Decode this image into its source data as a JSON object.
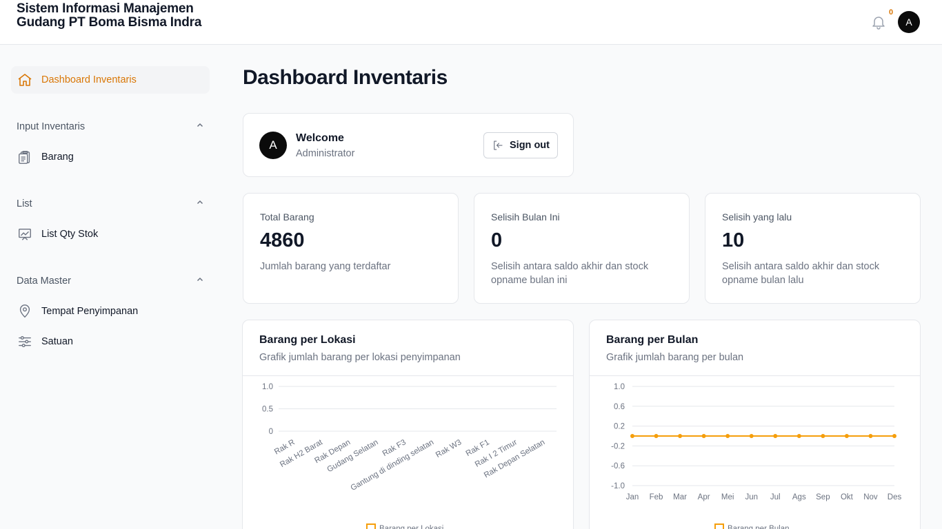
{
  "header": {
    "app_title": "Sistem Informasi Manajemen Gudang PT Boma Bisma Indra",
    "notification_count": "0",
    "avatar_initial": "A"
  },
  "sidebar": {
    "dashboard_label": "Dashboard Inventaris",
    "sections": [
      {
        "label": "Input Inventaris",
        "items": [
          {
            "label": "Barang",
            "icon": "clipboard-icon"
          }
        ]
      },
      {
        "label": "List",
        "items": [
          {
            "label": "List Qty Stok",
            "icon": "chart-board-icon"
          }
        ]
      },
      {
        "label": "Data Master",
        "items": [
          {
            "label": "Tempat Penyimpanan",
            "icon": "map-pin-icon"
          },
          {
            "label": "Satuan",
            "icon": "sliders-icon"
          }
        ]
      }
    ]
  },
  "main": {
    "page_title": "Dashboard Inventaris",
    "welcome": {
      "avatar_initial": "A",
      "title": "Welcome",
      "role": "Administrator",
      "signout_label": "Sign out"
    },
    "stats": [
      {
        "label": "Total Barang",
        "value": "4860",
        "desc": "Jumlah barang yang terdaftar"
      },
      {
        "label": "Selisih Bulan Ini",
        "value": "0",
        "desc": "Selisih antara saldo akhir dan stock opname bulan ini"
      },
      {
        "label": "Selisih yang lalu",
        "value": "10",
        "desc": "Selisih antara saldo akhir dan stock opname bulan lalu"
      }
    ],
    "charts": [
      {
        "title": "Barang per Lokasi",
        "subtitle": "Grafik jumlah barang per lokasi penyimpanan"
      },
      {
        "title": "Barang per Bulan",
        "subtitle": "Grafik jumlah barang per bulan"
      }
    ]
  },
  "colors": {
    "accent": "#d97706",
    "line": "#f59e0b",
    "text": "#111827",
    "muted": "#6b7280",
    "border": "#e5e7eb"
  },
  "chart_data": [
    {
      "type": "bar",
      "title": "Barang per Lokasi",
      "categories": [
        "Rak R",
        "Rak H2 Barat",
        "Rak Depan",
        "Gudang Selatan",
        "Rak F3",
        "Gantung di dinding selatan",
        "Rak W3",
        "Rak F1",
        "Rak I 2 Timur",
        "Rak Depan Selatan"
      ],
      "series": [
        {
          "name": "Barang per Lokasi",
          "values": [
            0,
            0,
            0,
            0,
            0,
            0,
            0,
            0,
            0,
            0
          ]
        }
      ],
      "yticks": [
        "1.0",
        "0.5",
        "0"
      ],
      "ylim": [
        0,
        1
      ],
      "legend": "bottom",
      "grid": true
    },
    {
      "type": "line",
      "title": "Barang per Bulan",
      "categories": [
        "Jan",
        "Feb",
        "Mar",
        "Apr",
        "Mei",
        "Jun",
        "Jul",
        "Ags",
        "Sep",
        "Okt",
        "Nov",
        "Des"
      ],
      "series": [
        {
          "name": "Barang per Bulan",
          "values": [
            0,
            0,
            0,
            0,
            0,
            0,
            0,
            0,
            0,
            0,
            0,
            0
          ]
        }
      ],
      "yticks": [
        "1.0",
        "0.6",
        "0.2",
        "-0.2",
        "-0.6",
        "-1.0"
      ],
      "ylim": [
        -1,
        1
      ],
      "legend": "bottom",
      "grid": true
    }
  ]
}
